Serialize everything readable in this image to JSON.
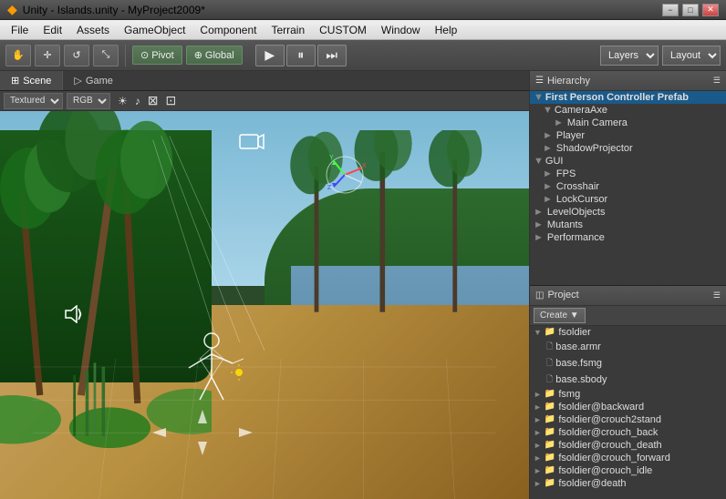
{
  "titleBar": {
    "title": "Unity - Islands.unity - MyProject2009*",
    "minimize": "−",
    "maximize": "□",
    "close": "✕"
  },
  "menuBar": {
    "items": [
      "File",
      "Edit",
      "Assets",
      "GameObject",
      "Component",
      "Terrain",
      "CUSTOM",
      "Window",
      "Help"
    ]
  },
  "toolbar": {
    "hand": "✋",
    "move": "✛",
    "rotate": "↺",
    "scale": "⤡",
    "pivot": "Pivot",
    "global": "Global",
    "play": "▶",
    "pause": "⏸",
    "step": "⏭",
    "layers": "Layers",
    "layout": "Layout",
    "layersDropdown": "▼",
    "layoutDropdown": "▼"
  },
  "sceneTabs": {
    "scene": "Scene",
    "game": "Game"
  },
  "sceneToolbar": {
    "shading": "Textured",
    "channel": "RGB",
    "light": "☀",
    "audio": "♪"
  },
  "hierarchy": {
    "header": "Hierarchy",
    "items": [
      {
        "label": "First Person Controller Prefab",
        "level": 0,
        "expanded": true,
        "selected": true
      },
      {
        "label": "CameraAxe",
        "level": 1,
        "expanded": true
      },
      {
        "label": "Main Camera",
        "level": 2,
        "expanded": false
      },
      {
        "label": "Player",
        "level": 1,
        "expanded": false
      },
      {
        "label": "ShadowProjector",
        "level": 1,
        "expanded": false
      },
      {
        "label": "GUI",
        "level": 0,
        "expanded": true
      },
      {
        "label": "FPS",
        "level": 1,
        "expanded": false
      },
      {
        "label": "Crosshair",
        "level": 1,
        "expanded": false
      },
      {
        "label": "LockCursor",
        "level": 1,
        "expanded": false
      },
      {
        "label": "LevelObjects",
        "level": 0,
        "expanded": false
      },
      {
        "label": "Mutants",
        "level": 0,
        "expanded": false
      },
      {
        "label": "Performance",
        "level": 0,
        "expanded": false
      }
    ]
  },
  "project": {
    "header": "Project",
    "createBtn": "Create ▼",
    "items": [
      {
        "label": "fsoldier",
        "level": 0,
        "type": "folder",
        "expanded": true
      },
      {
        "label": "base.armr",
        "level": 1,
        "type": "file"
      },
      {
        "label": "base.fsmg",
        "level": 1,
        "type": "file"
      },
      {
        "label": "base.sbody",
        "level": 1,
        "type": "file"
      },
      {
        "label": "fsmg",
        "level": 0,
        "type": "folder",
        "expanded": false
      },
      {
        "label": "fsoldier@backward",
        "level": 0,
        "type": "folder",
        "expanded": false
      },
      {
        "label": "fsoldier@crouch2stand",
        "level": 0,
        "type": "folder",
        "expanded": false
      },
      {
        "label": "fsoldier@crouch_back",
        "level": 0,
        "type": "folder",
        "expanded": false
      },
      {
        "label": "fsoldier@crouch_death",
        "level": 0,
        "type": "folder",
        "expanded": false
      },
      {
        "label": "fsoldier@crouch_forward",
        "level": 0,
        "type": "folder",
        "expanded": false
      },
      {
        "label": "fsoldier@crouch_idle",
        "level": 0,
        "type": "folder",
        "expanded": false
      },
      {
        "label": "fsoldier@death",
        "level": 0,
        "type": "folder",
        "expanded": false
      }
    ]
  }
}
